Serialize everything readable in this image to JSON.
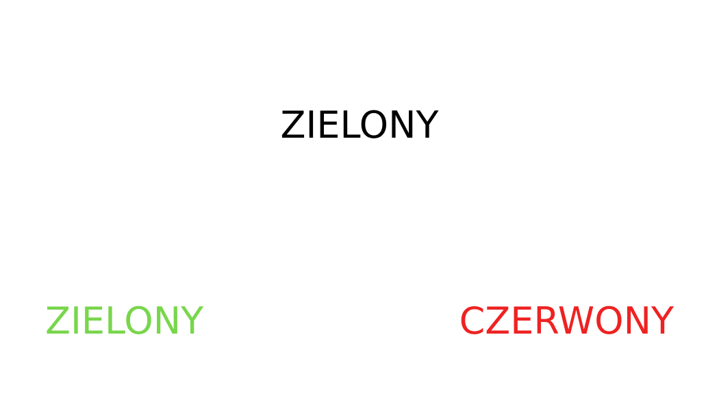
{
  "prompt": {
    "text": "ZIELONY",
    "color": "#000000"
  },
  "choices": [
    {
      "text": "ZIELONY",
      "color": "#78d64b"
    },
    {
      "text": "CZERWONY",
      "color": "#ee2222"
    }
  ]
}
